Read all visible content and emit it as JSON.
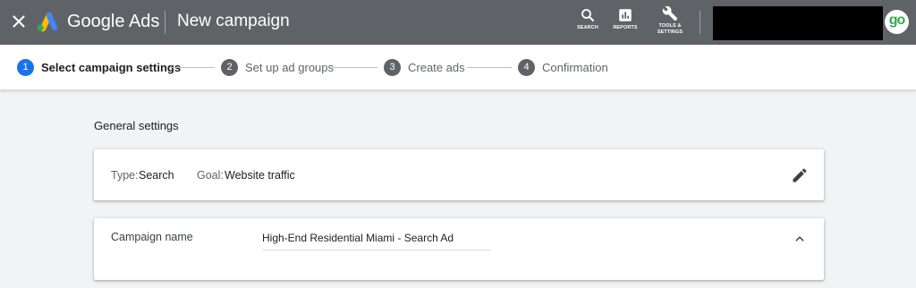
{
  "header": {
    "brand": "Google Ads",
    "page_title": "New campaign",
    "tools": {
      "search_label": "SEARCH",
      "reports_label": "REPORTS",
      "tools_label_line1": "TOOLS &",
      "tools_label_line2": "SETTINGS"
    },
    "avatar_text": "go",
    "colors": {
      "bar": "#5f6368",
      "avatar_text": "#34a853"
    }
  },
  "stepper": {
    "steps": [
      {
        "num": "1",
        "label": "Select campaign settings",
        "active": true
      },
      {
        "num": "2",
        "label": "Set up ad groups"
      },
      {
        "num": "3",
        "label": "Create ads"
      },
      {
        "num": "4",
        "label": "Confirmation"
      }
    ],
    "colors": {
      "active": "#1a73e8",
      "inactive": "#5f6368"
    }
  },
  "general": {
    "title": "General settings",
    "type_label": "Type:",
    "type_value": "Search",
    "goal_label": "Goal:",
    "goal_value": "Website traffic"
  },
  "campaign_name": {
    "label": "Campaign name",
    "value": "High-End Residential Miami - Search Ad"
  },
  "icons": [
    "close-icon",
    "google-ads-logo-icon",
    "search-icon",
    "reports-icon",
    "wrench-icon",
    "pencil-icon",
    "chevron-up-icon"
  ]
}
